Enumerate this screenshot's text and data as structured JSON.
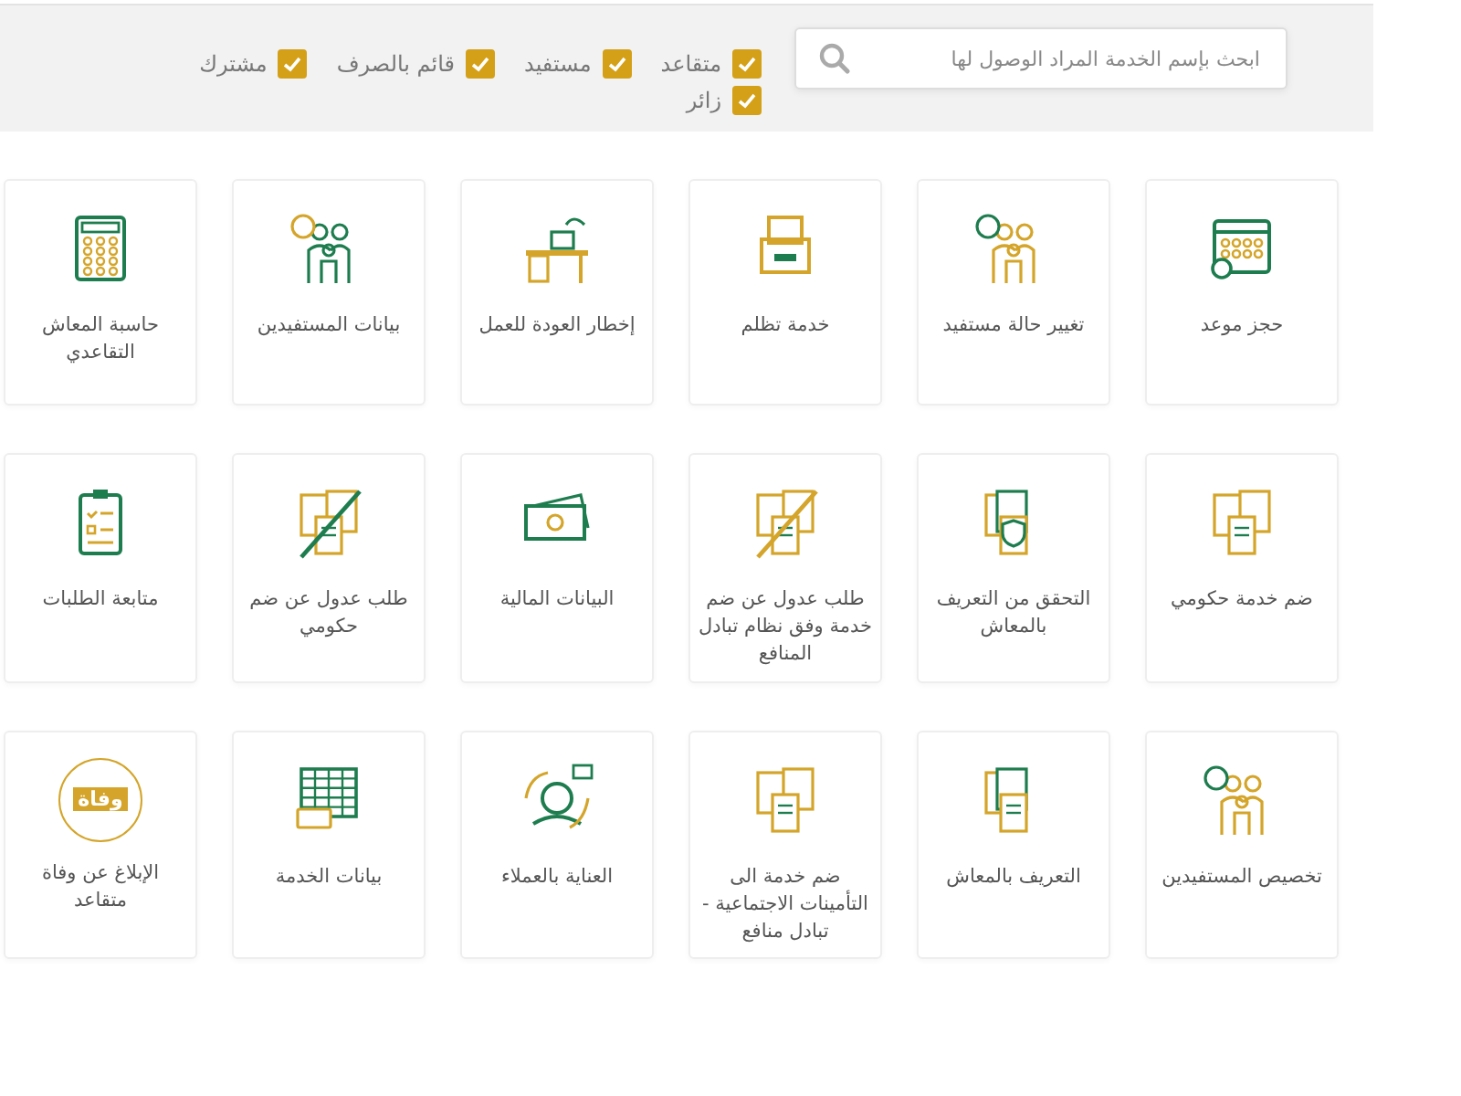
{
  "search": {
    "placeholder": "ابحث بإسم الخدمة المراد الوصول لها"
  },
  "filters": [
    {
      "label": "متقاعد",
      "checked": true
    },
    {
      "label": "مستفيد",
      "checked": true
    },
    {
      "label": "قائم بالصرف",
      "checked": true
    },
    {
      "label": "مشترك",
      "checked": true
    },
    {
      "label": "زائر",
      "checked": true
    }
  ],
  "services": [
    {
      "title": "حجز موعد"
    },
    {
      "title": "تغيير حالة مستفيد"
    },
    {
      "title": "خدمة تظلم"
    },
    {
      "title": "إخطار العودة للعمل"
    },
    {
      "title": "بيانات المستفيدين"
    },
    {
      "title": "حاسبة المعاش التقاعدي"
    },
    {
      "title": "ضم خدمة حكومي"
    },
    {
      "title": "التحقق من التعريف بالمعاش"
    },
    {
      "title": "طلب عدول عن ضم خدمة وفق نظام تبادل المنافع"
    },
    {
      "title": "البيانات المالية"
    },
    {
      "title": "طلب عدول عن ضم حكومي"
    },
    {
      "title": "متابعة الطلبات"
    },
    {
      "title": "تخصيص المستفيدين"
    },
    {
      "title": "التعريف بالمعاش"
    },
    {
      "title": "ضم خدمة الى التأمينات الاجتماعية - تبادل منافع"
    },
    {
      "title": "العناية بالعملاء"
    },
    {
      "title": "بيانات الخدمة"
    },
    {
      "title": "الإبلاغ عن وفاة متقاعد",
      "icon_text": "وفاة"
    }
  ]
}
